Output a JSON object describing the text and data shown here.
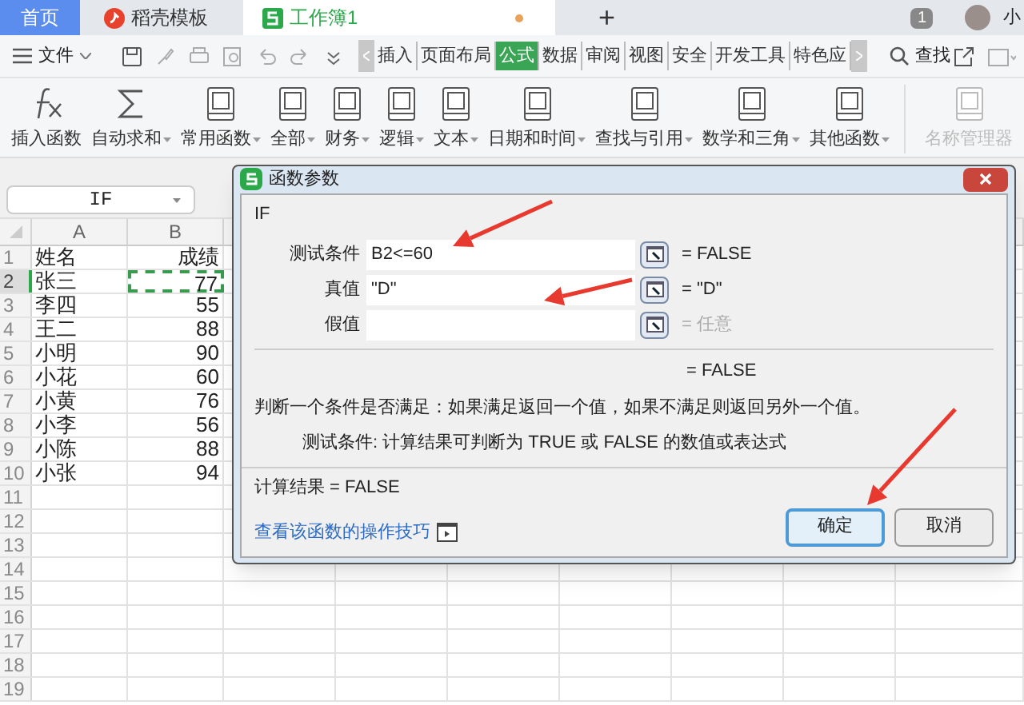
{
  "tabs": [
    {
      "kind": "home",
      "label": "首页",
      "selected": false
    },
    {
      "kind": "template",
      "label": "稻壳模板",
      "selected": false
    },
    {
      "kind": "workbook",
      "label": "工作簿1",
      "selected": true,
      "modified": true
    }
  ],
  "new_tab": "+",
  "tab_count": "1",
  "user_name": "小",
  "menu": {
    "file": "文件",
    "tabs": [
      {
        "label": "插入",
        "selected": false
      },
      {
        "label": "页面布局",
        "selected": false
      },
      {
        "label": "公式",
        "selected": true
      },
      {
        "label": "数据",
        "selected": false
      },
      {
        "label": "审阅",
        "selected": false
      },
      {
        "label": "视图",
        "selected": false
      },
      {
        "label": "安全",
        "selected": false
      },
      {
        "label": "开发工具",
        "selected": false
      },
      {
        "label": "特色应",
        "selected": false
      }
    ],
    "search": "查找"
  },
  "ribbon": [
    {
      "label": "插入函数",
      "dropdown": false,
      "disabled": false
    },
    {
      "label": "自动求和",
      "dropdown": true,
      "disabled": false
    },
    {
      "label": "常用函数",
      "dropdown": true,
      "disabled": false
    },
    {
      "label": "全部",
      "dropdown": true,
      "disabled": false
    },
    {
      "label": "财务",
      "dropdown": true,
      "disabled": false
    },
    {
      "label": "逻辑",
      "dropdown": true,
      "disabled": false
    },
    {
      "label": "文本",
      "dropdown": true,
      "disabled": false
    },
    {
      "label": "日期和时间",
      "dropdown": true,
      "disabled": false
    },
    {
      "label": "查找与引用",
      "dropdown": true,
      "disabled": false
    },
    {
      "label": "数学和三角",
      "dropdown": true,
      "disabled": false
    },
    {
      "label": "其他函数",
      "dropdown": true,
      "disabled": false
    },
    {
      "label": "名称管理器",
      "dropdown": false,
      "disabled": true
    }
  ],
  "name_box": "IF",
  "sheet": {
    "columns": [
      "A",
      "B"
    ],
    "rows": [
      {
        "number": "1",
        "cells": [
          "姓名",
          "成绩"
        ],
        "selected": false
      },
      {
        "number": "2",
        "cells": [
          "张三",
          "77"
        ],
        "selected": true
      },
      {
        "number": "3",
        "cells": [
          "李四",
          "55"
        ],
        "selected": false
      },
      {
        "number": "4",
        "cells": [
          "王二",
          "88"
        ],
        "selected": false
      },
      {
        "number": "5",
        "cells": [
          "小明",
          "90"
        ],
        "selected": false
      },
      {
        "number": "6",
        "cells": [
          "小花",
          "60"
        ],
        "selected": false
      },
      {
        "number": "7",
        "cells": [
          "小黄",
          "76"
        ],
        "selected": false
      },
      {
        "number": "8",
        "cells": [
          "小李",
          "56"
        ],
        "selected": false
      },
      {
        "number": "9",
        "cells": [
          "小陈",
          "88"
        ],
        "selected": false
      },
      {
        "number": "10",
        "cells": [
          "小张",
          "94"
        ],
        "selected": false
      },
      {
        "number": "11",
        "cells": [
          "",
          ""
        ],
        "selected": false
      },
      {
        "number": "12",
        "cells": [
          "",
          ""
        ],
        "selected": false
      },
      {
        "number": "13",
        "cells": [
          "",
          ""
        ],
        "selected": false
      },
      {
        "number": "14",
        "cells": [
          "",
          ""
        ],
        "selected": false
      },
      {
        "number": "15",
        "cells": [
          "",
          ""
        ],
        "selected": false
      },
      {
        "number": "16",
        "cells": [
          "",
          ""
        ],
        "selected": false
      },
      {
        "number": "17",
        "cells": [
          "",
          ""
        ],
        "selected": false
      },
      {
        "number": "18",
        "cells": [
          "",
          ""
        ],
        "selected": false
      },
      {
        "number": "19",
        "cells": [
          "",
          ""
        ],
        "selected": false
      }
    ]
  },
  "dialog": {
    "title": "函数参数",
    "function": "IF",
    "arguments": [
      {
        "label": "测试条件",
        "value": "B2<=60",
        "result": "= FALSE",
        "placeholder_result": false
      },
      {
        "label": "真值",
        "value": "\"D\"",
        "result": "= \"D\"",
        "placeholder_result": false
      },
      {
        "label": "假值",
        "result": "= 任意",
        "placeholder_result": true
      }
    ],
    "overall": "= FALSE",
    "description": "判断一个条件是否满足：如果满足返回一个值，如果不满足则返回另外一个值。",
    "argument_help": "测试条件:  计算结果可判断为 TRUE 或 FALSE 的数值或表达式",
    "result": "计算结果 = FALSE",
    "help_link": "查看该函数的操作技巧",
    "buttons": [
      {
        "label": "确定",
        "selected": true
      },
      {
        "label": "取消",
        "selected": false
      }
    ]
  }
}
